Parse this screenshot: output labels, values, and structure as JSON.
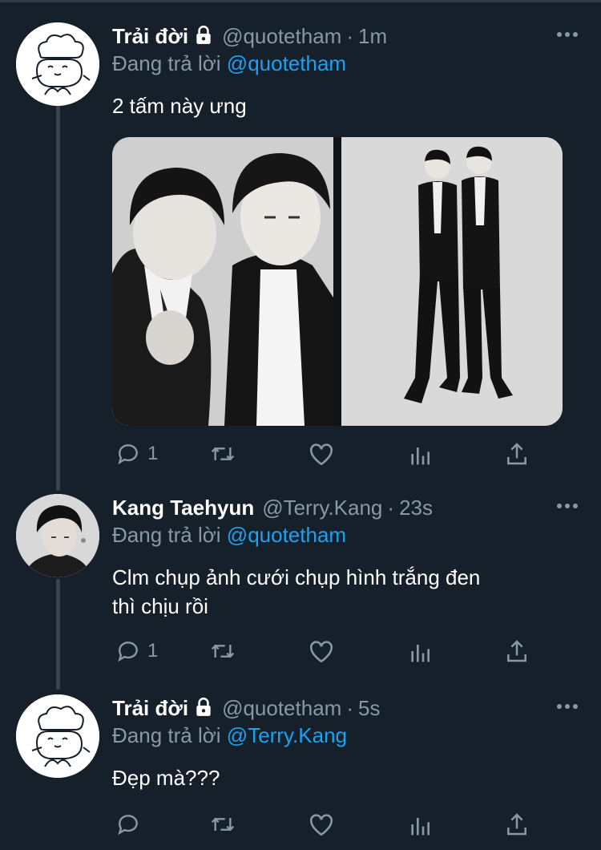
{
  "tweets": [
    {
      "name": "Trải đời",
      "handle": "@quotetham",
      "time": "1m",
      "replying_prefix": "Đang trả lời",
      "replying_to": "@quotetham",
      "text": "2 tấm này ưng",
      "reply_count": "1",
      "has_media": true,
      "avatar": "chef-doodle-avatar"
    },
    {
      "name": "Kang Taehyun",
      "handle": "@Terry.Kang",
      "time": "23s",
      "replying_prefix": "Đang trả lời",
      "replying_to": "@quotetham",
      "text_line1": "Clm chụp ảnh cưới chụp hình trắng đen",
      "text_line2": "thì chịu rồi",
      "reply_count": "1",
      "avatar": "photo-avatar"
    },
    {
      "name": "Trải đời",
      "handle": "@quotetham",
      "time": "5s",
      "replying_prefix": "Đang trả lời",
      "replying_to": "@Terry.Kang",
      "text": "Đẹp mà???",
      "reply_count": "",
      "avatar": "chef-doodle-avatar"
    }
  ],
  "separator": "·",
  "icons": [
    "reply-icon",
    "retweet-icon",
    "like-icon",
    "analytics-icon",
    "share-icon",
    "more-icon",
    "lock-icon"
  ],
  "colors": {
    "background": "#15202b",
    "secondary_text": "#8899a6",
    "link": "#1da1f2",
    "thread_line": "#38444d"
  }
}
